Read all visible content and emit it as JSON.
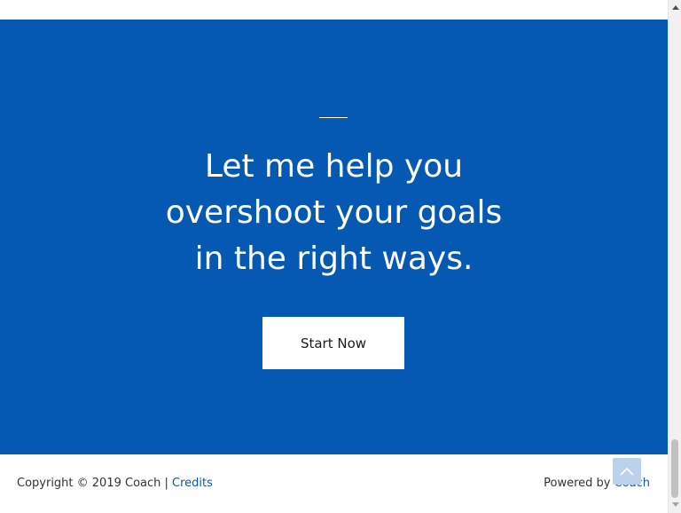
{
  "hero": {
    "heading_lines": [
      "Let me help you",
      "overshoot your goals",
      "in the right ways."
    ],
    "cta_label": "Start Now",
    "background_color": "#0659b3"
  },
  "footer": {
    "copyright_text": "Copyright © 2019 Coach | ",
    "credits_link": "Credits",
    "powered_by_text": "Powered by ",
    "powered_by_link": "Coach",
    "link_color": "#0659b3"
  },
  "scroll_to_top": {
    "icon": "chevron-up-icon"
  },
  "scrollbar": {
    "up_icon": "scroll-up-arrow-icon",
    "down_icon": "scroll-down-arrow-icon"
  }
}
